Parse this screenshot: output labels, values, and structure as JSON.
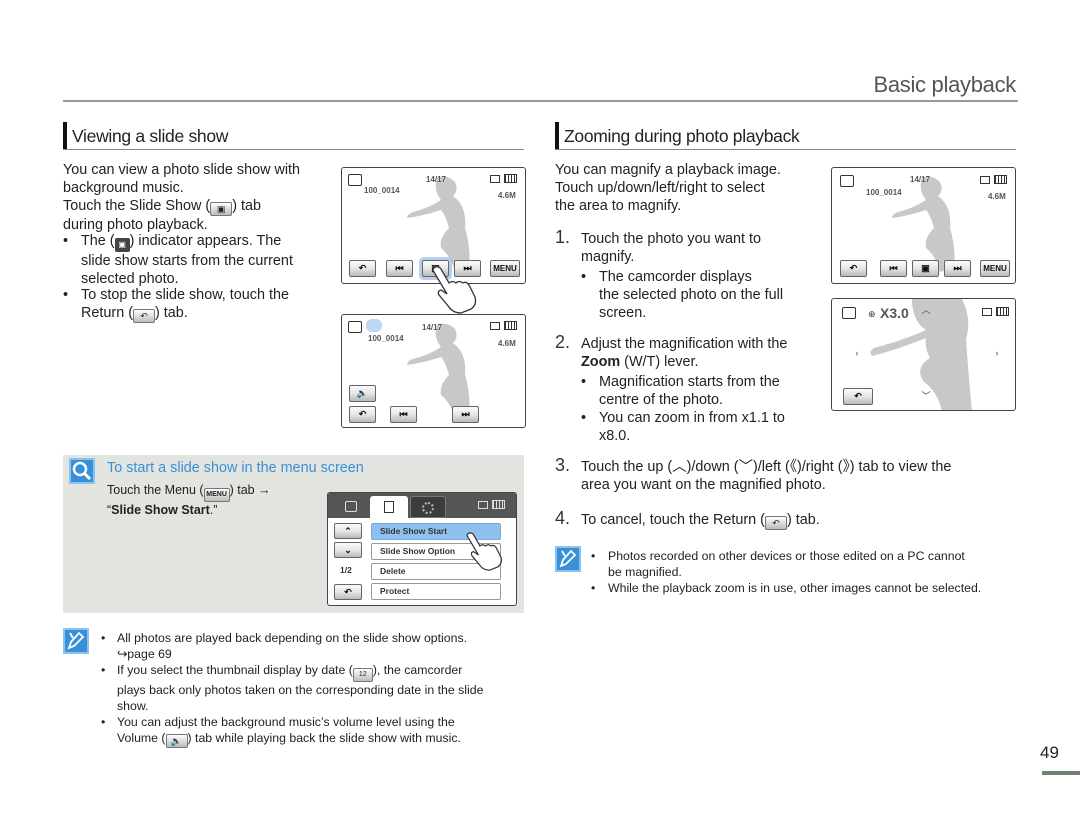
{
  "header": {
    "title": "Basic playback"
  },
  "left": {
    "heading": "Viewing a slide show",
    "intro_1": "You can view a photo slide show with",
    "intro_2": "background music.",
    "intro_3a": "Touch the Slide Show (",
    "intro_3b": ") tab",
    "intro_4": "during photo playback.",
    "bullets": [
      {
        "a": "The (",
        "b": ") indicator appears. The",
        "c": "slide show starts from the current",
        "d": "selected photo."
      },
      {
        "a": "To stop the slide show, touch the",
        "b": "Return (",
        "c": ") tab."
      }
    ],
    "screen1": {
      "file": "100_0014",
      "counter": "14/17",
      "resolution": "4.6M",
      "menu_label": "MENU"
    },
    "screen2": {
      "file": "100_0014",
      "counter": "14/17",
      "resolution": "4.6M"
    },
    "tip": {
      "title": "To start a slide show in the menu screen",
      "line1a": "Touch the Menu (",
      "line1b": ") tab →",
      "line2_open": "“",
      "line2_bold": "Slide Show Start",
      "line2_close": ".”",
      "menu_icon_label": "MENU",
      "menu": {
        "page": "1/2",
        "items": [
          "Slide Show Start",
          "Slide Show Option",
          "Delete",
          "Protect"
        ],
        "selected": 0
      }
    },
    "notes": [
      {
        "text": "All photos are played back depending on the slide show options.",
        "ref": "↪page 69"
      },
      {
        "a": "If you select the thumbnail display by date (",
        "b": "), the camcorder",
        "c": "plays back only photos taken on the corresponding date in the slide",
        "d": "show.",
        "icon_label": "12"
      },
      {
        "a": "You can adjust the background music’s volume level using the",
        "b": "Volume (",
        "c": ") tab while playing back the slide show with music."
      }
    ]
  },
  "right": {
    "heading": "Zooming during photo playback",
    "intro": [
      "You can magnify a playback image.",
      "Touch up/down/left/right to select",
      "the area to magnify."
    ],
    "steps": [
      {
        "num": "1.",
        "lines": [
          "Touch the photo you want to",
          "magnify."
        ],
        "bullets": [
          [
            "The camcorder displays",
            "the selected photo on the full",
            "screen."
          ]
        ]
      },
      {
        "num": "2.",
        "line1": "Adjust the magnification with the",
        "bold": "Zoom",
        "rest": " (W/T) lever.",
        "bullets": [
          [
            "Magnification starts from the",
            "centre of the photo."
          ],
          [
            "You can zoom in from x1.1 to",
            "x8.0."
          ]
        ]
      },
      {
        "num": "3.",
        "a": "Touch the up (",
        "b": ")/down (",
        "c": ")/left (",
        "d": ")/right (",
        "e": ") tab to view the",
        "line2": "area you want on the magnified photo."
      },
      {
        "num": "4.",
        "a": "To cancel, touch the Return (",
        "b": ") tab."
      }
    ],
    "screen1": {
      "file": "100_0014",
      "counter": "14/17",
      "resolution": "4.6M",
      "menu_label": "MENU"
    },
    "screen2": {
      "zoom": "X3.0"
    },
    "notes": [
      [
        "Photos recorded on other devices or those edited on a PC cannot",
        "be magnified."
      ],
      [
        "While the playback zoom is in use, other images cannot be selected."
      ]
    ]
  },
  "footer": {
    "page_number": "49"
  },
  "colors": {
    "accent_blue": "#3a90d8",
    "tip_bg": "#e2e4df",
    "selected_row": "#8ec1f0",
    "page_bar": "#6f826f"
  }
}
